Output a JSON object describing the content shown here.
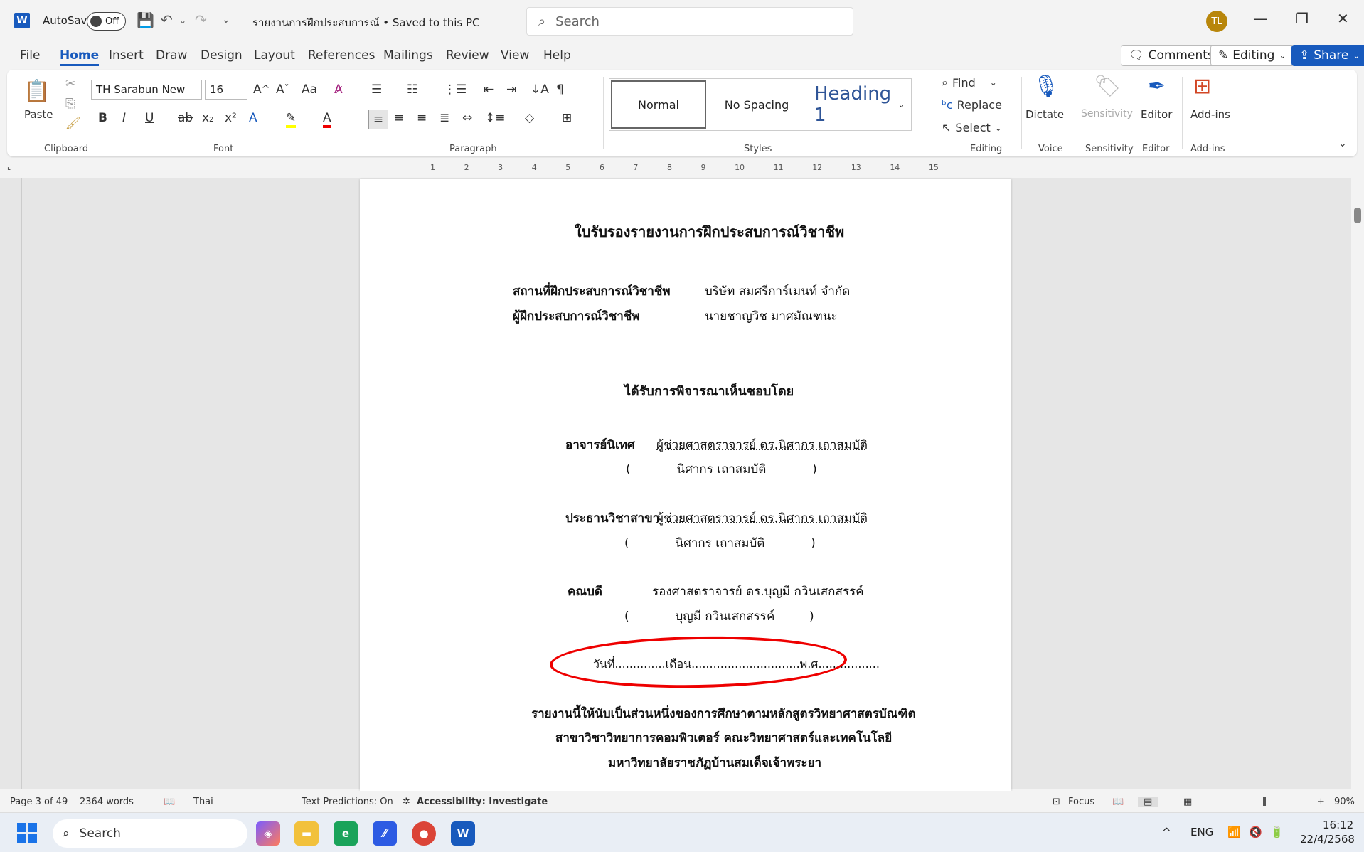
{
  "titlebar": {
    "app_icon": "W",
    "autosave_label": "AutoSave",
    "autosave_state": "Off",
    "doc_title": "รายงานการฝึกประสบการณ์ • Saved to this PC",
    "search_placeholder": "Search",
    "avatar": "TL"
  },
  "menu": [
    "File",
    "Home",
    "Insert",
    "Draw",
    "Design",
    "Layout",
    "References",
    "Mailings",
    "Review",
    "View",
    "Help"
  ],
  "right_buttons": {
    "comments": "Comments",
    "editing": "Editing",
    "share": "Share"
  },
  "ribbon": {
    "clipboard": {
      "paste": "Paste",
      "label": "Clipboard"
    },
    "font": {
      "name": "TH Sarabun New",
      "size": "16",
      "label": "Font"
    },
    "paragraph": {
      "label": "Paragraph"
    },
    "styles": {
      "normal": "Normal",
      "no_spacing": "No Spacing",
      "heading": "Heading 1",
      "label": "Styles"
    },
    "editing": {
      "find": "Find",
      "replace": "Replace",
      "select": "Select",
      "label": "Editing"
    },
    "voice": {
      "dictate": "Dictate",
      "label": "Voice"
    },
    "sensitivity": {
      "button": "Sensitivity",
      "label": "Sensitivity"
    },
    "editor": {
      "button": "Editor",
      "label": "Editor"
    },
    "addins": {
      "button": "Add-ins",
      "label": "Add-ins"
    }
  },
  "ruler_marks": [
    "1",
    "2",
    "3",
    "4",
    "5",
    "6",
    "7",
    "8",
    "9",
    "10",
    "11",
    "12",
    "13",
    "14",
    "15"
  ],
  "doc": {
    "title": "ใบรับรองรายงานการฝึกประสบการณ์วิชาชีพ",
    "place_label": "สถานที่ฝึกประสบการณ์วิชาชีพ",
    "place_value": "บริษัท สมศรีการ์เมนท์ จำกัด",
    "trainee_label": "ผู้ฝึกประสบการณ์วิชาชีพ",
    "trainee_value": "นายชาญวิช มาศมัณฑนะ",
    "approved": "ได้รับการพิจารณาเห็นชอบโดย",
    "advisor_label": "อาจารย์นิเทศ",
    "advisor_value": "ผู้ช่วยศาสตราจารย์ ดร.นิศากร เถาสมบัติ",
    "advisor_name": "(            นิศากร เถาสมบัติ            )",
    "chair_label": "ประธานวิชาสาขา",
    "chair_value": "ผู้ช่วยศาสตราจารย์ ดร.นิศากร เถาสมบัติ",
    "chair_name": "(            นิศากร เถาสมบัติ            )",
    "dean_label": "คณบดี",
    "dean_value": "รองศาสตราจารย์ ดร.บุญมี กวินเสกสรรค์",
    "dean_name": "(            บุญมี กวินเสกสรรค์         )",
    "date_line": "วันที่..............เดือน..............................พ.ศ.................",
    "footer1": "รายงานนี้ให้นับเป็นส่วนหนึ่งของการศึกษาตามหลักสูตรวิทยาศาสตรบัณฑิต",
    "footer2": "สาขาวิชาวิทยาการคอมพิวเตอร์ คณะวิทยาศาสตร์และเทคโนโลยี",
    "footer3": "มหาวิทยาลัยราชภัฏบ้านสมเด็จเจ้าพระยา"
  },
  "status": {
    "page": "Page 3 of 49",
    "words": "2364 words",
    "language": "Thai",
    "predictions": "Text Predictions: On",
    "accessibility": "Accessibility: Investigate",
    "focus": "Focus",
    "zoom": "90%"
  },
  "taskbar": {
    "search": "Search",
    "lang": "ENG",
    "time": "16:12",
    "date": "22/4/2568"
  }
}
